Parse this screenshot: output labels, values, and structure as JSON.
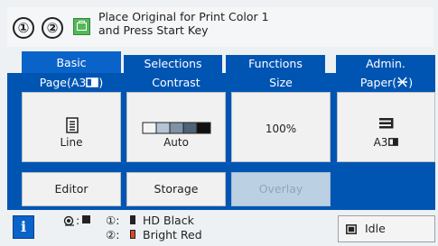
{
  "message": {
    "icon_1": "①",
    "icon_2": "②",
    "line1": "Place Original for Print Color 1",
    "line2": "and Press Start Key"
  },
  "tabs": [
    {
      "label": "Basic",
      "active": true
    },
    {
      "label": "Selections",
      "active": false
    },
    {
      "label": "Functions",
      "active": false
    },
    {
      "label": "Admin.",
      "active": false
    }
  ],
  "columns": {
    "page": "Page(A3",
    "contrast": "Contrast",
    "size": "Size",
    "paper": "Paper("
  },
  "buttons": {
    "line": "Line",
    "contrast_value": "Auto",
    "size_value": "100%",
    "paper_value": "A3"
  },
  "bottom_buttons": {
    "editor": "Editor",
    "storage": "Storage",
    "overlay": "Overlay"
  },
  "status": {
    "drum1_label": "①:",
    "drum1_color": "HD Black",
    "drum2_label": "②:",
    "drum2_color": "Bright Red",
    "idle": "Idle"
  },
  "colors": {
    "tab_blue": "#0055b3",
    "black_ink": "#222222",
    "red_ink": "#d84a2a"
  },
  "icons": {
    "info": "i",
    "cross": "✕"
  }
}
